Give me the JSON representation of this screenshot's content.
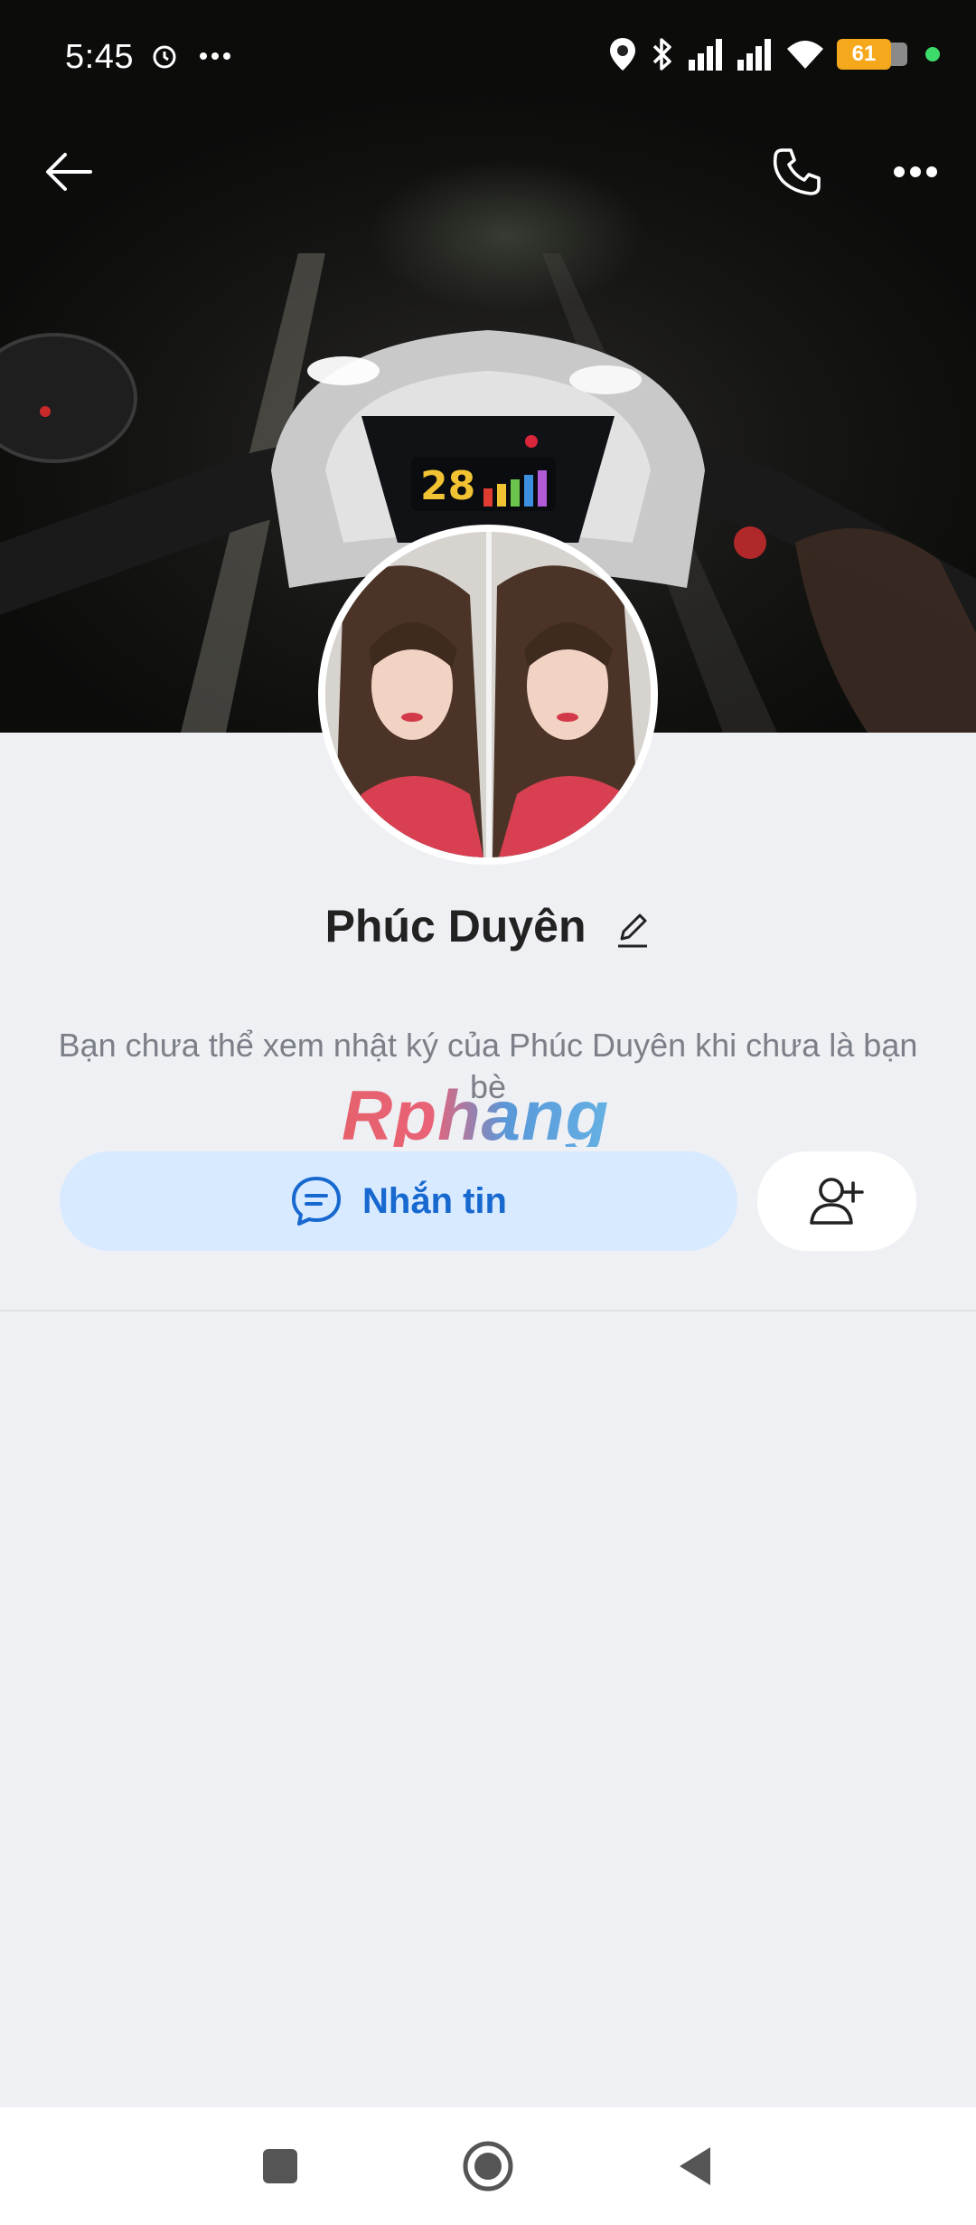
{
  "status_bar": {
    "time": "5:45",
    "battery": "61",
    "icons": [
      "alarm-icon",
      "more-dots-icon",
      "location-icon",
      "bluetooth-icon",
      "signal-icon",
      "signal-icon",
      "wifi-icon",
      "battery-icon",
      "privacy-dot"
    ]
  },
  "header": {
    "back_icon": "back-arrow-icon",
    "call_icon": "phone-icon",
    "menu_icon": "more-horizontal-icon"
  },
  "profile": {
    "name": "Phúc Duyên",
    "edit_icon": "pencil-icon",
    "notice": "Bạn chưa thể xem nhật ký của Phúc Duyên khi chưa là bạn bè"
  },
  "watermark": "Rphang",
  "actions": {
    "message_label": "Nhắn tin",
    "message_icon": "chat-bubble-icon",
    "add_friend_icon": "add-user-icon"
  },
  "colors": {
    "accent": "#1769d0",
    "message_button_bg": "#d8eaff",
    "page_bg": "#eff0f4",
    "battery": "#f5a81c"
  },
  "nav": {
    "icons": [
      "recents-square-icon",
      "home-circle-icon",
      "back-triangle-icon"
    ]
  }
}
